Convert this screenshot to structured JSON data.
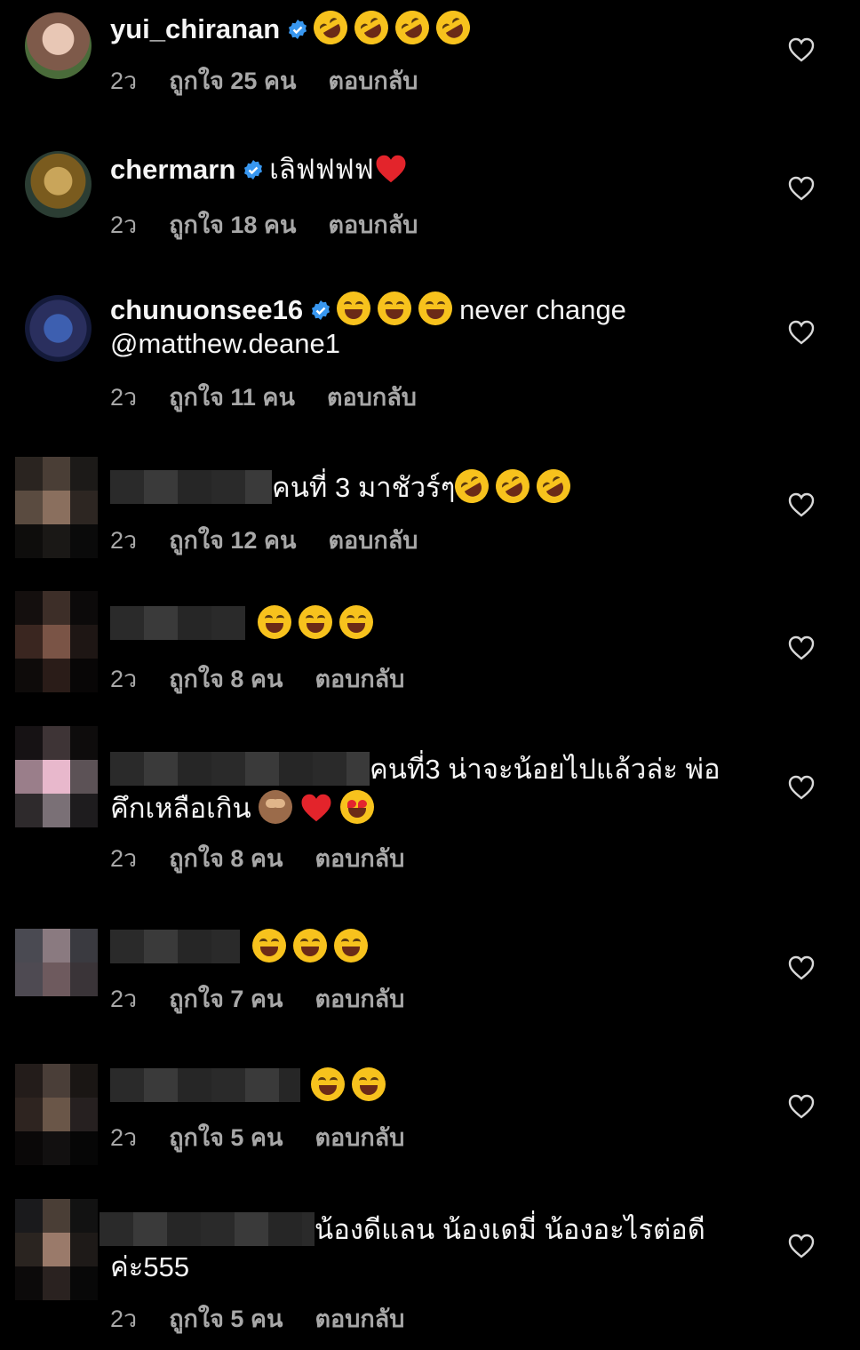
{
  "colors": {
    "background": "#000000",
    "text": "#f5f5f5",
    "meta": "#a8a8a8",
    "verified": "#3897f0"
  },
  "comments": [
    {
      "username": "yui_chiranan",
      "text": "",
      "time": "2ว",
      "likes": "ถูกใจ 25 คน",
      "reply": "ตอบกลับ"
    },
    {
      "username": "chermarn",
      "text": "เลิฟฟฟฟ",
      "time": "2ว",
      "likes": "ถูกใจ 18 คน",
      "reply": "ตอบกลับ"
    },
    {
      "username": "chunuonsee16",
      "text": "never change",
      "text2": "@matthew.deane1",
      "time": "2ว",
      "likes": "ถูกใจ 11 คน",
      "reply": "ตอบกลับ"
    },
    {
      "text": "คนที่ 3 มาชัวร์ๆ",
      "time": "2ว",
      "likes": "ถูกใจ 12 คน",
      "reply": "ตอบกลับ"
    },
    {
      "text": "",
      "time": "2ว",
      "likes": "ถูกใจ 8 คน",
      "reply": "ตอบกลับ"
    },
    {
      "text": "คนที่3 น่าจะน้อยไปแล้วล่ะ พ่อ",
      "text2": "คึกเหลือเกิน",
      "time": "2ว",
      "likes": "ถูกใจ 8 คน",
      "reply": "ตอบกลับ"
    },
    {
      "text": "",
      "time": "2ว",
      "likes": "ถูกใจ 7 คน",
      "reply": "ตอบกลับ"
    },
    {
      "text": "",
      "time": "2ว",
      "likes": "ถูกใจ 5 คน",
      "reply": "ตอบกลับ"
    },
    {
      "text": "น้องดีแลน น้องเดมี่ น้องอะไรต่อดี",
      "text2": "ค่ะ555",
      "time": "2ว",
      "likes": "ถูกใจ 5 คน",
      "reply": "ตอบกลับ"
    }
  ],
  "icons": {
    "like": "heart-outline-icon",
    "verified": "verified-badge-icon"
  }
}
